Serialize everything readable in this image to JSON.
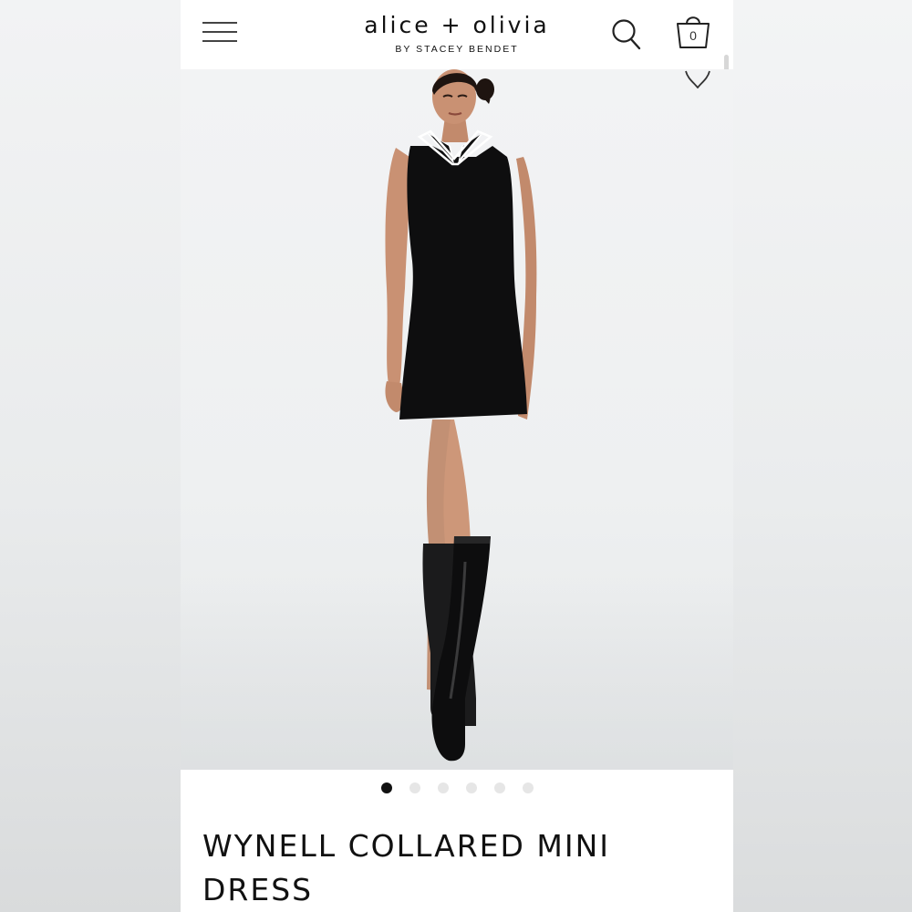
{
  "header": {
    "brand_name": "alice + olivia",
    "brand_subtitle": "BY STACEY BENDET",
    "menu_icon": "hamburger-menu-icon",
    "search_icon": "search-icon",
    "bag_icon": "shopping-bag-icon",
    "bag_count": "0"
  },
  "gallery": {
    "wishlist_icon": "heart-icon",
    "image_subject": "model wearing black sleeveless collared mini dress with knee-high black boots",
    "dots_total": 6,
    "active_index": 0
  },
  "product": {
    "title": "WYNELL COLLARED MINI DRESS"
  },
  "colors": {
    "text": "#111111",
    "dress": "#0e0e0f",
    "skin": "#c99173",
    "dot_active": "#111111",
    "dot_inactive": "#e6e6e6"
  }
}
